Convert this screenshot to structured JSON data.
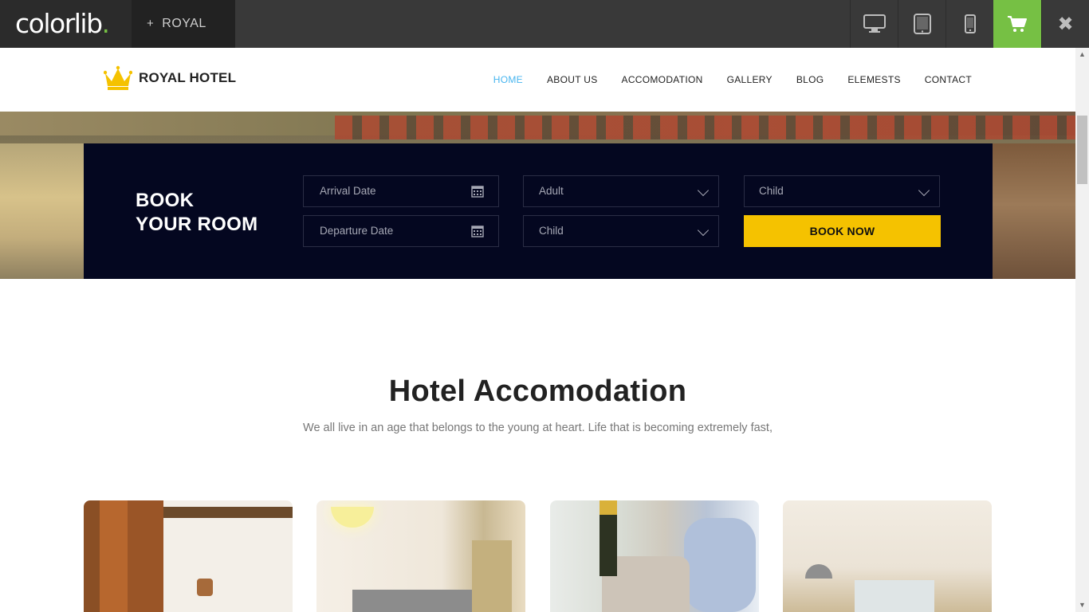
{
  "colorlib": {
    "logo_text": "colorlib",
    "logo_dot": ".",
    "theme_plus": "+",
    "theme_name": "ROYAL",
    "close_glyph": "✖",
    "accent": "#76c044"
  },
  "site": {
    "brand": "ROYAL HOTEL",
    "nav": [
      {
        "label": "HOME",
        "active": true
      },
      {
        "label": "ABOUT US"
      },
      {
        "label": "ACCOMODATION"
      },
      {
        "label": "GALLERY"
      },
      {
        "label": "BLOG"
      },
      {
        "label": "ELEMESTS"
      },
      {
        "label": "CONTACT"
      }
    ],
    "active_color": "#47b5ef"
  },
  "booking": {
    "title_line1": "BOOK",
    "title_line2": "YOUR ROOM",
    "arrival_placeholder": "Arrival Date",
    "departure_placeholder": "Departure Date",
    "adult_select": "Adult",
    "child_select_1": "Child",
    "child_select_2": "Child",
    "button_label": "BOOK NOW",
    "button_color": "#f5c200",
    "panel_color": "#040720"
  },
  "section": {
    "title": "Hotel Accomodation",
    "subtitle": "We all live in an age that belongs to the young at heart. Life that is becoming extremely fast,"
  }
}
